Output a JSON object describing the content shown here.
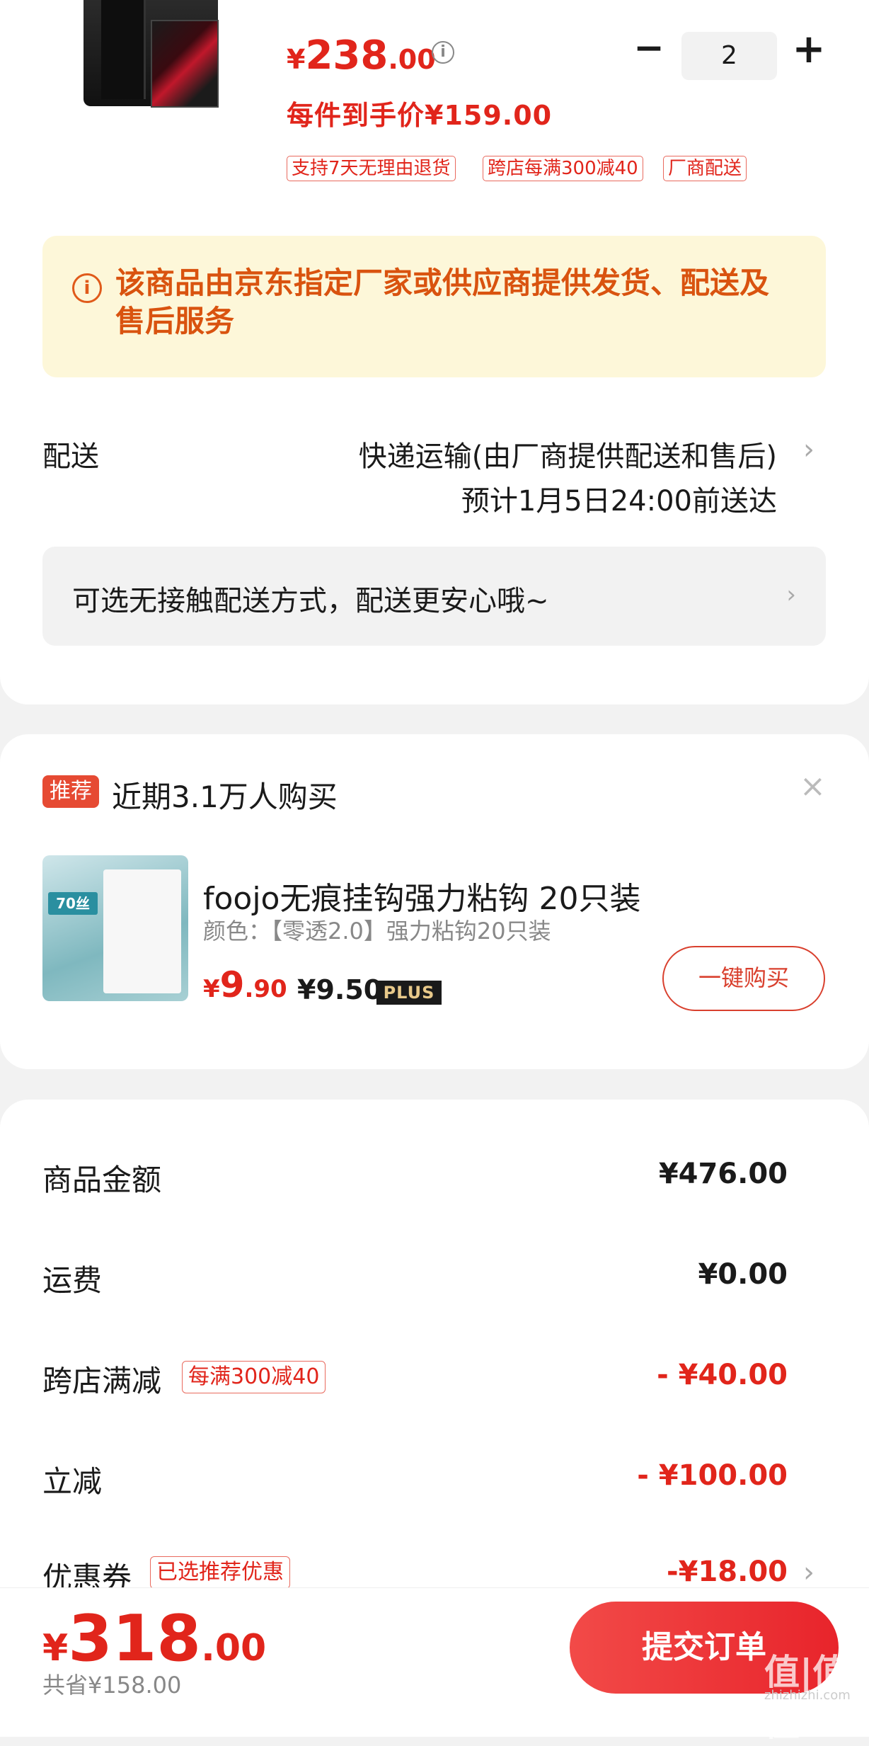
{
  "product": {
    "price_yen": "¥",
    "price_int": "238",
    "price_dec": ".00",
    "quantity": "2",
    "hand_price": "每件到手价¥159.00",
    "tags": [
      "支持7天无理由退货",
      "跨店每满300减40",
      "厂商配送"
    ]
  },
  "notice": {
    "icon": "info-icon",
    "text": "该商品由京东指定厂家或供应商提供发货、配送及售后服务"
  },
  "shipping": {
    "label": "配送",
    "method": "快递运输(由厂商提供配送和售后)",
    "eta": "预计1月5日24:00前送达",
    "contactless": "可选无接触配送方式，配送更安心哦~"
  },
  "recommend": {
    "badge": "推荐",
    "title": "近期3.1万人购买",
    "item_name": "foojo无痕挂钩强力粘钩 20只装",
    "item_spec": "颜色：【零透2.0】强力粘钩20只装",
    "price_yen": "¥",
    "price_int": "9",
    "price_dec": ".90",
    "plus_price": "¥9.50",
    "plus_label": "PLUS",
    "buy_label": "一键购买",
    "img_badge": "70丝"
  },
  "summary": {
    "goods_label": "商品金额",
    "goods_value": "¥476.00",
    "freight_label": "运费",
    "freight_value": "¥0.00",
    "cross_label": "跨店满减",
    "cross_tag": "每满300减40",
    "cross_value": "- ¥40.00",
    "instant_label": "立减",
    "instant_value": "- ¥100.00",
    "coupon_label": "优惠券",
    "coupon_tag": "已选推荐优惠",
    "coupon_value": "-¥18.00"
  },
  "footer": {
    "total_yen": "¥",
    "total_int": "318",
    "total_dec": ".00",
    "saved": "共省¥158.00",
    "submit_label": "提交订单",
    "watermark": "值|值|值",
    "watermark_site": "zhizhizhi.com"
  },
  "colors": {
    "accent": "#e1251b",
    "notice_bg": "#fdf7d9",
    "notice_text": "#d9530f"
  }
}
